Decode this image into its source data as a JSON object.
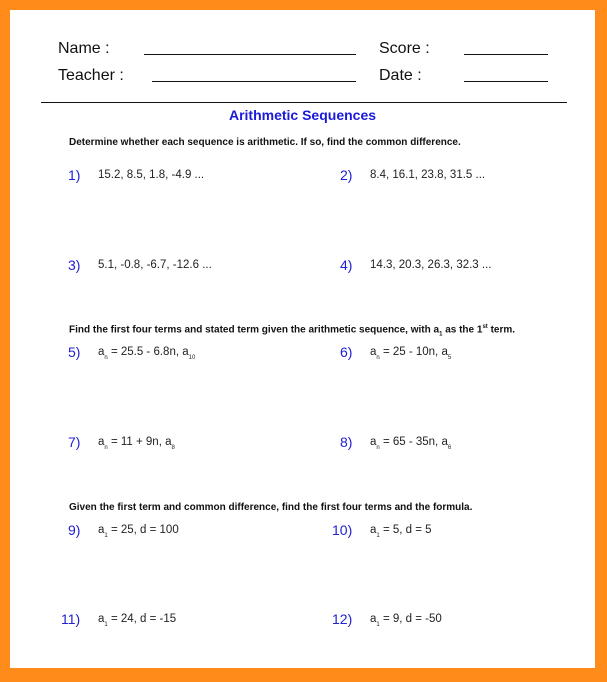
{
  "header": {
    "name_label": "Name :",
    "teacher_label": "Teacher :",
    "score_label": "Score :",
    "date_label": "Date :"
  },
  "title": "Arithmetic Sequences",
  "sections": [
    {
      "instruction": "Determine whether each sequence is arithmetic. If so, find the common difference.",
      "problems": [
        {
          "num": "1)",
          "text": "15.2, 8.5, 1.8, -4.9 ..."
        },
        {
          "num": "2)",
          "text": "8.4, 16.1, 23.8, 31.5 ..."
        },
        {
          "num": "3)",
          "text": "5.1, -0.8, -6.7, -12.6 ..."
        },
        {
          "num": "4)",
          "text": "14.3, 20.3, 26.3, 32.3 ..."
        }
      ]
    },
    {
      "instruction_pre": "Find the first four terms and stated term given the arithmetic sequence, with a",
      "instruction_sub": "1",
      "instruction_mid": " as the 1",
      "instruction_sup": "st",
      "instruction_post": " term.",
      "problems": [
        {
          "num": "5)",
          "var": "a",
          "sub": "n",
          "expr": " = 25.5 - 6.8n, a",
          "term_sub": "10"
        },
        {
          "num": "6)",
          "var": "a",
          "sub": "n",
          "expr": " = 25 - 10n, a",
          "term_sub": "5"
        },
        {
          "num": "7)",
          "var": "a",
          "sub": "n",
          "expr": " = 11 + 9n, a",
          "term_sub": "8"
        },
        {
          "num": "8)",
          "var": "a",
          "sub": "n",
          "expr": " = 65 - 35n, a",
          "term_sub": "6"
        }
      ]
    },
    {
      "instruction": "Given the first term and common difference, find the first four terms and the formula.",
      "problems": [
        {
          "num": "9)",
          "var": "a",
          "sub": "1",
          "expr": " = 25, d = 100"
        },
        {
          "num": "10)",
          "var": "a",
          "sub": "1",
          "expr": " = 5, d = 5"
        },
        {
          "num": "11)",
          "var": "a",
          "sub": "1",
          "expr": " = 24, d = -15"
        },
        {
          "num": "12)",
          "var": "a",
          "sub": "1",
          "expr": " = 9, d = -50"
        }
      ]
    }
  ],
  "colors": {
    "border": "#ff8c1a",
    "title": "#1a1adb",
    "problem_number": "#2020d0"
  }
}
